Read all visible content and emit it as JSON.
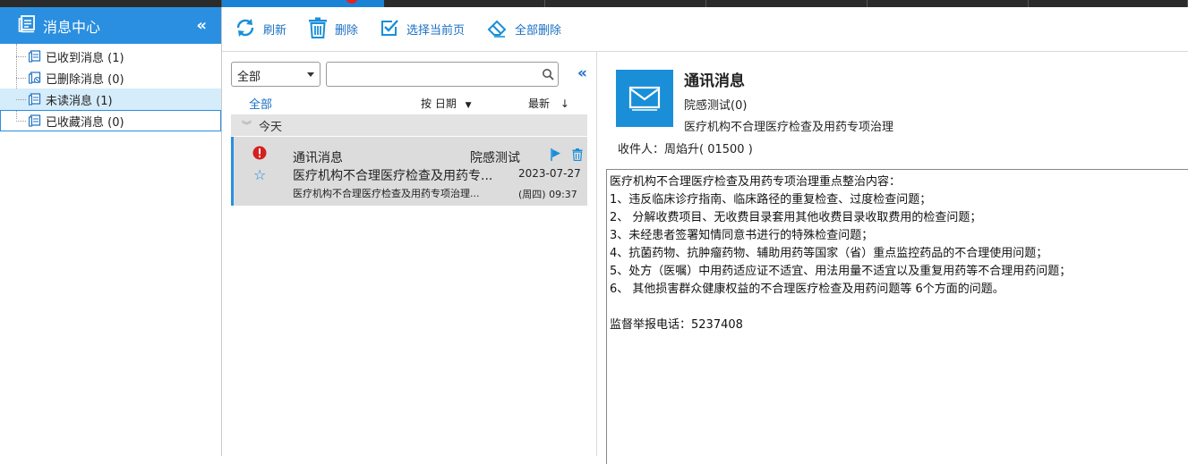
{
  "colors": {
    "accent": "#2a8fe0",
    "link": "#1a6fc4",
    "alert": "#d42020",
    "selected_row": "#dcdcdc"
  },
  "sidebar": {
    "title": "消息中心",
    "collapse_icon": "double-chevron-left-icon",
    "items": [
      {
        "label": "已收到消息 (1)",
        "icon": "inbox-icon"
      },
      {
        "label": "已删除消息 (0)",
        "icon": "deleted-messages-icon"
      },
      {
        "label": "未读消息 (1)",
        "icon": "unread-messages-icon"
      },
      {
        "label": "已收藏消息 (0)",
        "icon": "favorite-messages-icon"
      }
    ]
  },
  "toolbar": {
    "refresh": "刷新",
    "delete": "删除",
    "select_page": "选择当前页",
    "delete_all": "全部删除"
  },
  "list": {
    "filter_selected": "全部",
    "search_placeholder": "",
    "all_label": "全部",
    "sort_by_date": "按 日期",
    "sort_newest": "最新",
    "group_today": "今天",
    "messages": [
      {
        "category": "通讯消息",
        "sender": "院感测试",
        "subject": "医疗机构不合理医疗检查及用药专...",
        "date": "2023-07-27",
        "preview": "医疗机构不合理医疗检查及用药专项治理...",
        "weekday_time": "(周四) 09:37"
      }
    ]
  },
  "detail": {
    "title": "通讯消息",
    "sender": "院感测试(0)",
    "subject": "医疗机构不合理医疗检查及用药专项治理",
    "recipient": "收件人：周焰升( 01500 )",
    "body_lines": [
      "医疗机构不合理医疗检查及用药专项治理重点整治内容：",
      "1、违反临床诊疗指南、临床路径的重复检查、过度检查问题；",
      "2、 分解收费项目、无收费目录套用其他收费目录收取费用的检查问题；",
      "3、未经患者签署知情同意书进行的特殊检查问题；",
      "4、抗菌药物、抗肿瘤药物、辅助用药等国家（省）重点监控药品的不合理使用问题；",
      "5、处方（医嘱）中用药适应证不适宜、用法用量不适宜以及重复用药等不合理用药问题；",
      "6、 其他损害群众健康权益的不合理医疗检查及用药问题等 6个方面的问题。",
      "",
      "监督举报电话：5237408"
    ]
  }
}
